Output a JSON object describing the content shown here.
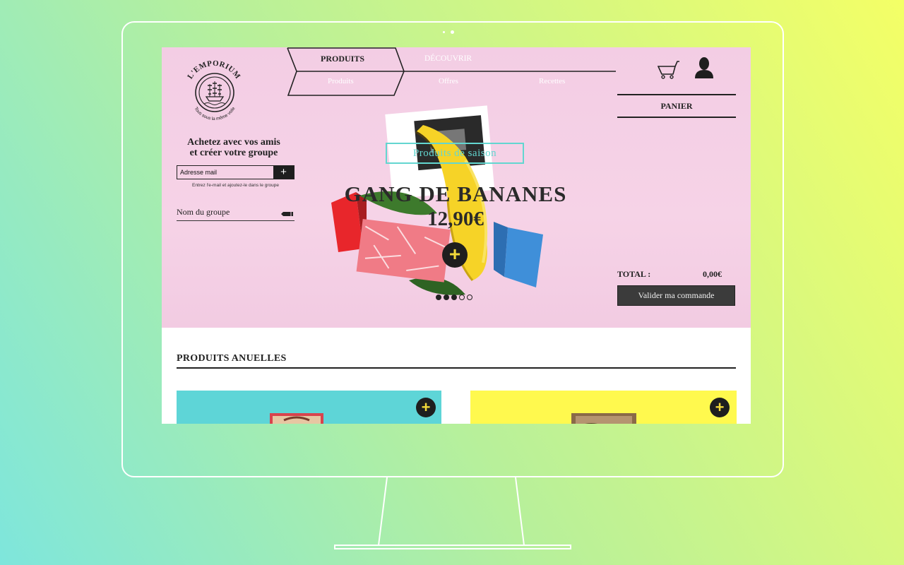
{
  "brand": {
    "name": "L'EMPORIUM",
    "tagline": "Tous sous la même voile"
  },
  "nav": {
    "main_items": [
      {
        "label": "PRODUITS",
        "active": true
      },
      {
        "label": "DÉCOUVRIR",
        "active": false
      }
    ],
    "sub_items": [
      "Produits",
      "Offres",
      "Recettes"
    ]
  },
  "sidebar": {
    "title_line1": "Achetez avec vos amis",
    "title_line2": "et créer votre groupe",
    "email_placeholder": "Adresse mail",
    "email_add_label": "+",
    "email_hint": "Entrez l'e-mail et ajoutez-le dans le groupe",
    "group_name_label": "Nom du groupe"
  },
  "hero": {
    "badge": "Produits de saison",
    "title": "GANG DE BANANES",
    "price": "12,90€",
    "add_label": "+",
    "slides": [
      true,
      true,
      true,
      false,
      false
    ]
  },
  "cart": {
    "panier_label": "PANIER",
    "total_label": "TOTAL :",
    "total_value": "0,00€",
    "validate_label": "Valider ma commande"
  },
  "products_section": {
    "title": "PRODUITS ANUELLES",
    "cards": [
      {
        "color": "#5ed5d7",
        "add_label": "+"
      },
      {
        "color": "#fff94e",
        "add_label": "+"
      }
    ]
  },
  "colors": {
    "hero_bg": "#f4cfe5",
    "accent_teal": "#63d6d0",
    "dark": "#1e1e1e",
    "yellow": "#f3d93a"
  }
}
